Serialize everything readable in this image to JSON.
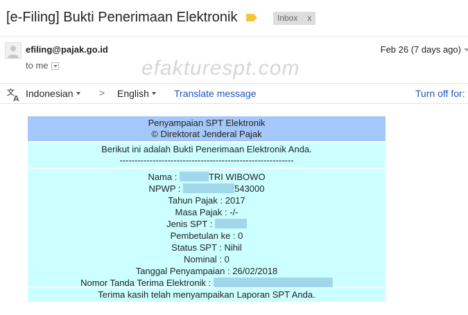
{
  "email": {
    "subject": "[e-Filing] Bukti Penerimaan Elektronik",
    "label_chip": {
      "text": "Inbox",
      "close": "x"
    },
    "sender": "efiling@pajak.go.id",
    "recipient": "to me",
    "date": "Feb 26 (7 days ago)",
    "watermark": "efakturespt.com"
  },
  "translate_bar": {
    "source_language": "Indonesian",
    "arrow": ">",
    "target_language": "English",
    "translate_link": "Translate message",
    "turn_off_link": "Turn off for:"
  },
  "receipt": {
    "header_line1": "Penyampaian SPT Elektronik",
    "header_line2": "© Direktorat Jenderal Pajak",
    "intro": "Berikut ini adalah Bukti Penerimaan Elektronik Anda.",
    "divider": "----------------------------------------------------------",
    "fields": {
      "nama_label": "Nama : ",
      "nama_value": "TRI WIBOWO",
      "npwp_label": "NPWP : ",
      "npwp_value": "543000",
      "tahun_pajak": "Tahun Pajak : 2017",
      "masa_pajak": "Masa Pajak : -/-",
      "jenis_spt_label": "Jenis SPT : ",
      "pembetulan": "Pembetulan ke : 0",
      "status_spt": "Status SPT : Nihil",
      "nominal": "Nominal : 0",
      "tanggal": "Tanggal Penyampaian : 26/02/2018",
      "ntte_label": "Nomor Tanda Terima Elektronik : "
    },
    "footer": "Terima kasih telah menyampaikan Laporan SPT Anda."
  },
  "colors": {
    "header_bg": "#a4c8fa",
    "section_bg": "#ccffff",
    "redaction": "#a2d6ea",
    "link": "#1a55c0",
    "label_tag": "#f4c638"
  }
}
